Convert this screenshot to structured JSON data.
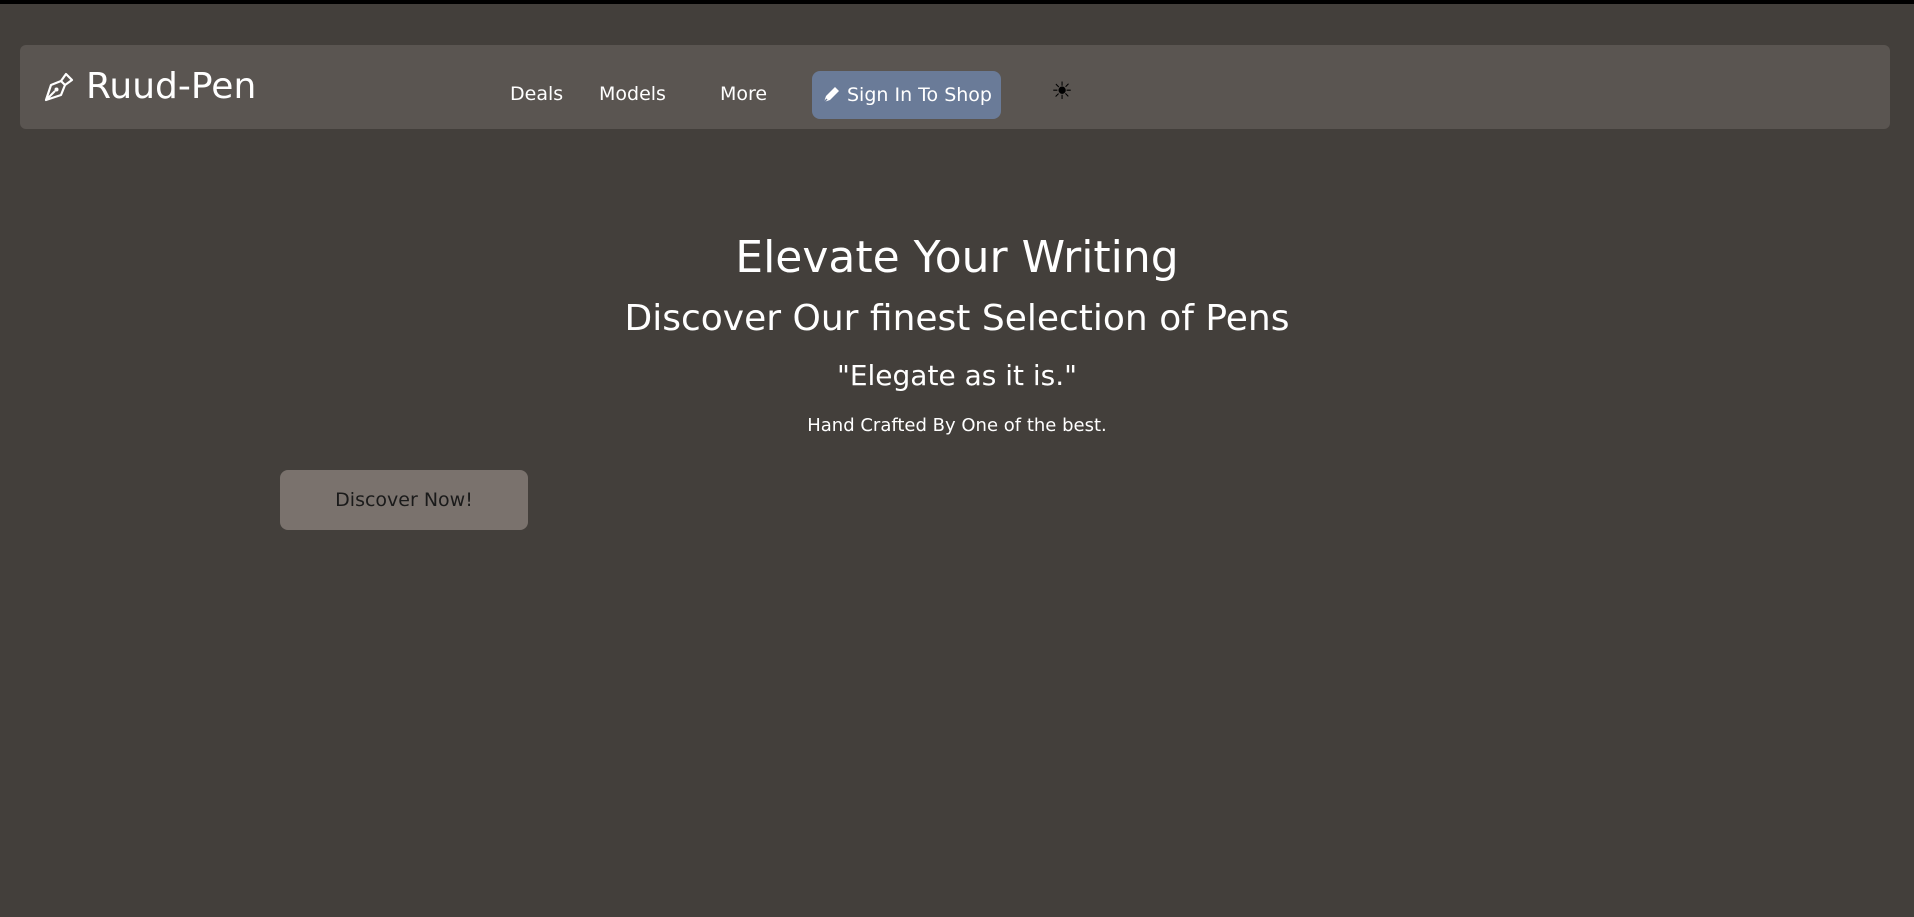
{
  "brand": {
    "name": "Ruud-Pen",
    "icon": "fountain-pen-icon"
  },
  "nav": {
    "links": [
      {
        "label": "Deals"
      },
      {
        "label": "Models"
      },
      {
        "label": "More"
      }
    ],
    "signin": {
      "label": "Sign In To Shop",
      "icon": "pen-icon",
      "color": "#6a7b98"
    },
    "theme_toggle": {
      "glyph": "☀",
      "icon": "sun-icon"
    }
  },
  "hero": {
    "title": "Elevate Your Writing",
    "subtitle": "Discover Our finest Selection of Pens",
    "quote": "\"Elegate as it is.\"",
    "tagline": "Hand Crafted By One of the best.",
    "cta_label": "Discover Now!"
  },
  "colors": {
    "background": "#433f3b",
    "navbar": "#5a5551",
    "cta": "#7a726d"
  }
}
